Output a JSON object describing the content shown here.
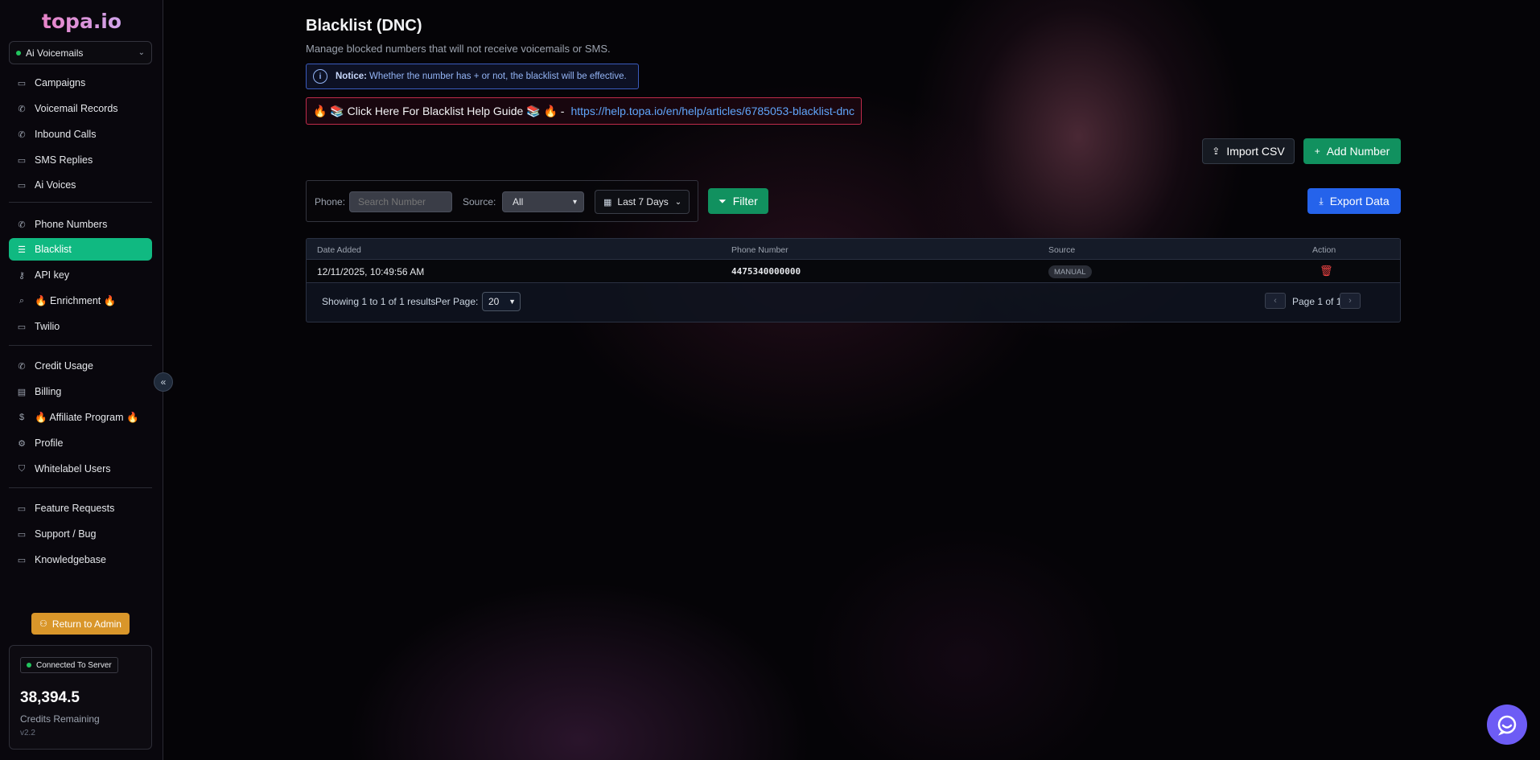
{
  "brand": {
    "logo_text": "topa.io"
  },
  "workspace": {
    "selected": "Ai Voicemails"
  },
  "sidebar": {
    "groups": [
      [
        {
          "label": "Campaigns",
          "icon": "message-square-icon"
        },
        {
          "label": "Voicemail Records",
          "icon": "phone-icon"
        },
        {
          "label": "Inbound Calls",
          "icon": "phone-icon"
        },
        {
          "label": "SMS Replies",
          "icon": "message-square-icon"
        },
        {
          "label": "Ai Voices",
          "icon": "message-square-icon"
        }
      ],
      [
        {
          "label": "Phone Numbers",
          "icon": "phone-icon"
        },
        {
          "label": "Blacklist",
          "icon": "list-icon",
          "active": true
        },
        {
          "label": "API key",
          "icon": "key-icon"
        },
        {
          "label": "🔥 Enrichment 🔥",
          "icon": "search-icon"
        },
        {
          "label": "Twilio",
          "icon": "message-square-icon"
        }
      ],
      [
        {
          "label": "Credit Usage",
          "icon": "phone-icon"
        },
        {
          "label": "Billing",
          "icon": "credit-card-icon"
        },
        {
          "label": "🔥 Affiliate Program 🔥",
          "icon": "dollar-icon"
        },
        {
          "label": "Profile",
          "icon": "gear-icon"
        },
        {
          "label": "Whitelabel Users",
          "icon": "shield-icon"
        }
      ],
      [
        {
          "label": "Feature Requests",
          "icon": "message-square-icon"
        },
        {
          "label": "Support / Bug",
          "icon": "message-square-icon"
        },
        {
          "label": "Knowledgebase",
          "icon": "message-square-icon"
        }
      ]
    ],
    "return_button": "Return to Admin",
    "connection_status": "Connected To Server",
    "credits_value": "38,394.5",
    "credits_label": "Credits Remaining",
    "version": "v2.2"
  },
  "page": {
    "title": "Blacklist (DNC)",
    "subtitle": "Manage blocked numbers that will not receive voicemails or SMS.",
    "notice_label": "Notice:",
    "notice_text": "Whether the number has + or not, the blacklist will be effective.",
    "help_text": "🔥 📚 Click Here For Blacklist Help Guide 📚 🔥 -",
    "help_link": "https://help.topa.io/en/help/articles/6785053-blacklist-dnc"
  },
  "actions": {
    "import_csv": "Import CSV",
    "add_number": "Add Number",
    "export_data": "Export Data"
  },
  "filters": {
    "phone_label": "Phone:",
    "phone_placeholder": "Search Number",
    "source_label": "Source:",
    "source_value": "All",
    "date_range": "Last 7 Days",
    "filter_button": "Filter"
  },
  "table": {
    "columns": [
      "Date Added",
      "Phone Number",
      "Source",
      "Action"
    ],
    "rows": [
      {
        "date_added": "12/11/2025, 10:49:56 AM",
        "phone": "4475340000000",
        "source": "MANUAL"
      }
    ],
    "summary": "Showing 1 to 1 of 1 results",
    "per_page_label": "Per Page:",
    "per_page_value": "20",
    "page_info": "Page 1 of 1"
  },
  "colors": {
    "accent_green": "#10b981",
    "primary_blue": "#2563eb",
    "danger_red": "#ef4444",
    "warning_amber": "#d9962a"
  }
}
